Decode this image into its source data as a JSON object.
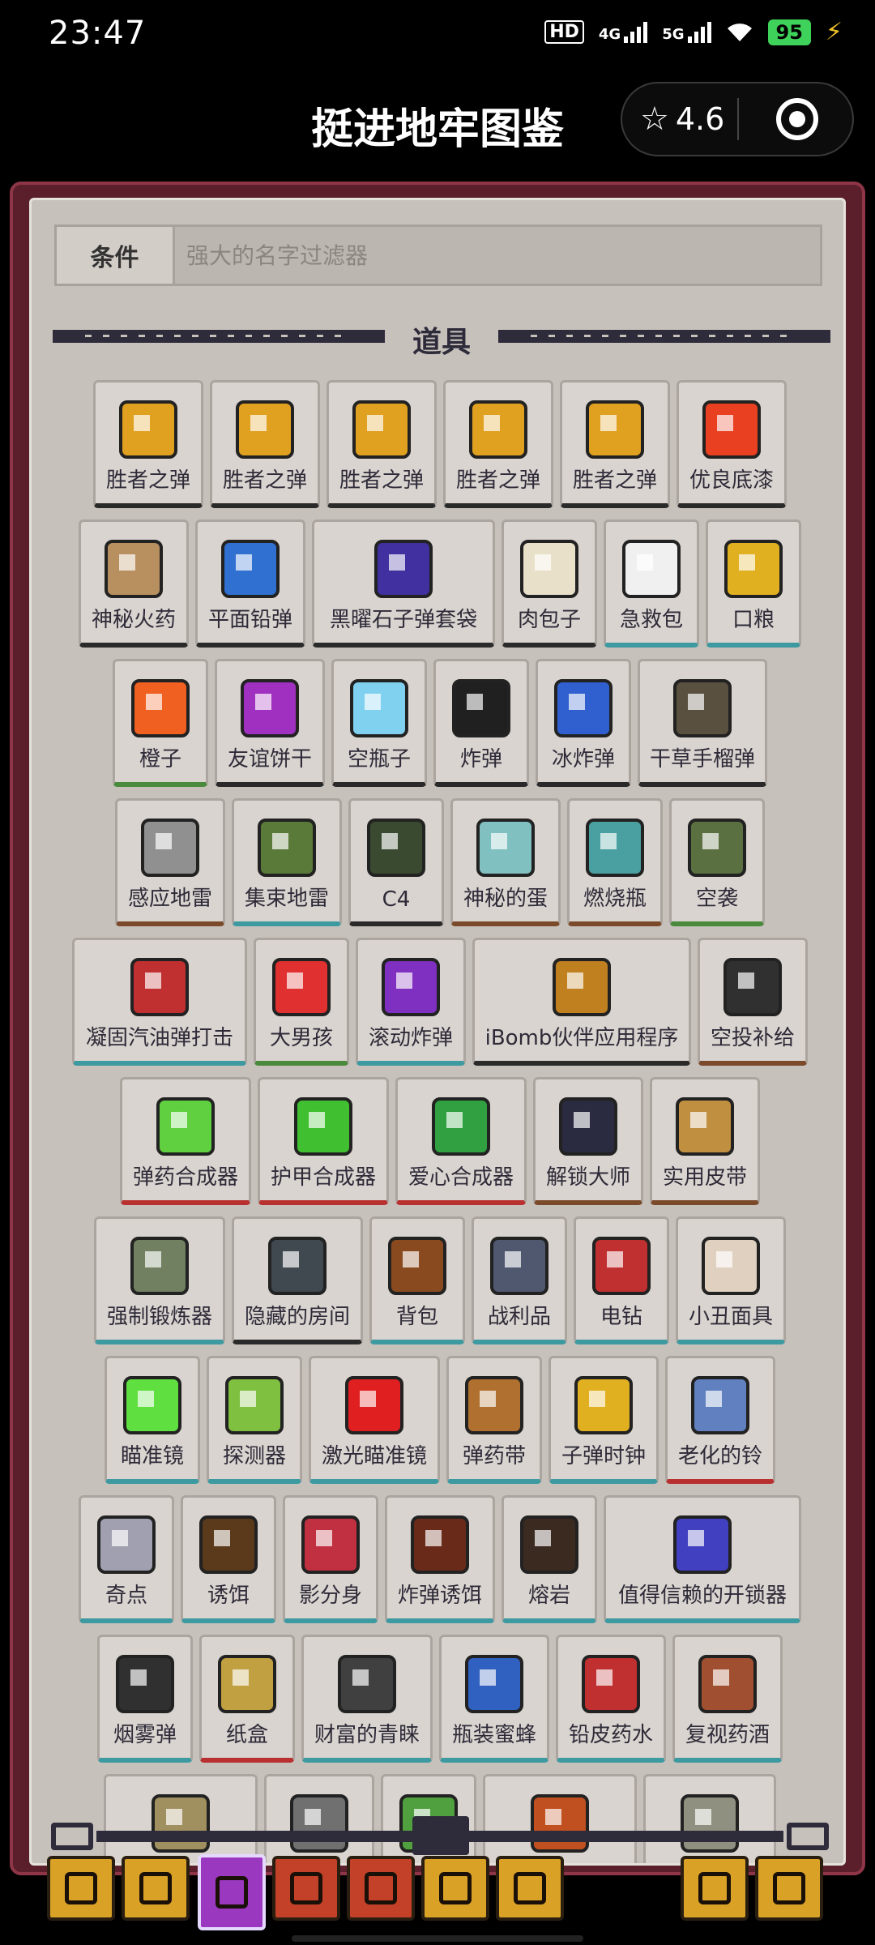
{
  "status": {
    "time": "23:47",
    "hd": "HD",
    "net1": "4G",
    "net2": "5G",
    "battery": "95"
  },
  "header": {
    "title": "挺进地牢图鉴",
    "rating": "4.6"
  },
  "search": {
    "condition_label": "条件",
    "placeholder": "强大的名字过滤器"
  },
  "section": {
    "title": "道具"
  },
  "colors": {
    "frame": "#5a1f2a",
    "panel": "#c7c1bc",
    "accent_selected_tab": "#9a38c0"
  },
  "rows": [
    [
      {
        "label": "胜者之弹",
        "icon": "bullet-i-icon",
        "color": "#e0a020",
        "edge": "b-blk"
      },
      {
        "label": "胜者之弹",
        "icon": "bullet-ii-icon",
        "color": "#e0a020",
        "edge": "b-blk"
      },
      {
        "label": "胜者之弹",
        "icon": "bullet-iii-icon",
        "color": "#e0a020",
        "edge": "b-blk"
      },
      {
        "label": "胜者之弹",
        "icon": "bullet-iv-icon",
        "color": "#e0a020",
        "edge": "b-blk"
      },
      {
        "label": "胜者之弹",
        "icon": "bullet-v-icon",
        "color": "#e0a020",
        "edge": "b-blk"
      },
      {
        "label": "优良底漆",
        "icon": "primer-icon",
        "color": "#e84020",
        "edge": "b-blk"
      }
    ],
    [
      {
        "label": "神秘火药",
        "icon": "powder-bag-icon",
        "color": "#b89060",
        "edge": "b-blk"
      },
      {
        "label": "平面铅弹",
        "icon": "blue-helmet-icon",
        "color": "#3070d0",
        "edge": "b-blk"
      },
      {
        "label": "黑曜石子弹套袋",
        "icon": "obsidian-pouch-icon",
        "color": "#4030a0",
        "edge": "b-blk"
      },
      {
        "label": "肉包子",
        "icon": "bun-icon",
        "color": "#e8e0c8",
        "edge": "b-blk"
      },
      {
        "label": "急救包",
        "icon": "medkit-icon",
        "color": "#f0f0f0",
        "edge": "b-teal"
      },
      {
        "label": "口粮",
        "icon": "ration-icon",
        "color": "#e0b020",
        "edge": "b-teal"
      }
    ],
    [
      {
        "label": "橙子",
        "icon": "orange-icon",
        "color": "#f06020",
        "edge": "b-grn"
      },
      {
        "label": "友谊饼干",
        "icon": "heart-cookie-icon",
        "color": "#a030c0",
        "edge": "b-blk"
      },
      {
        "label": "空瓶子",
        "icon": "bottle-icon",
        "color": "#80d0f0",
        "edge": "b-blk"
      },
      {
        "label": "炸弹",
        "icon": "bomb-icon",
        "color": "#202020",
        "edge": "b-blk"
      },
      {
        "label": "冰炸弹",
        "icon": "ice-bomb-icon",
        "color": "#3060d0",
        "edge": "b-blk"
      },
      {
        "label": "干草手榴弹",
        "icon": "grenade-icon",
        "color": "#5a5040",
        "edge": "b-blk"
      }
    ],
    [
      {
        "label": "感应地雷",
        "icon": "proximity-mine-icon",
        "color": "#909090",
        "edge": "b-brn"
      },
      {
        "label": "集束地雷",
        "icon": "cluster-mine-icon",
        "color": "#5a7a3a",
        "edge": "b-teal"
      },
      {
        "label": "C4",
        "icon": "c4-icon",
        "color": "#3a4a30",
        "edge": "b-blk"
      },
      {
        "label": "神秘的蛋",
        "icon": "egg-icon",
        "color": "#80c0c0",
        "edge": "b-brn"
      },
      {
        "label": "燃烧瓶",
        "icon": "molotov-icon",
        "color": "#4aa0a0",
        "edge": "b-brn"
      },
      {
        "label": "空袭",
        "icon": "airstrike-icon",
        "color": "#5a7040",
        "edge": "b-grn"
      }
    ],
    [
      {
        "label": "凝固汽油弹打击",
        "icon": "napalm-icon",
        "color": "#c03030",
        "edge": "b-teal"
      },
      {
        "label": "大男孩",
        "icon": "big-boy-icon",
        "color": "#e03030",
        "edge": "b-grn"
      },
      {
        "label": "滚动炸弹",
        "icon": "roll-bomb-icon",
        "color": "#8030c0",
        "edge": "b-teal"
      },
      {
        "label": "iBomb伙伴应用程序",
        "icon": "ibomb-icon",
        "color": "#c08020",
        "edge": "b-blk"
      },
      {
        "label": "空投补给",
        "icon": "radio-icon",
        "color": "#303030",
        "edge": "b-brn"
      }
    ],
    [
      {
        "label": "弹药合成器",
        "icon": "ammo-synth-icon",
        "color": "#60d040",
        "edge": "b-red"
      },
      {
        "label": "护甲合成器",
        "icon": "armor-synth-icon",
        "color": "#40c030",
        "edge": "b-red"
      },
      {
        "label": "爱心合成器",
        "icon": "heart-synth-icon",
        "color": "#30a040",
        "edge": "b-red"
      },
      {
        "label": "解锁大师",
        "icon": "unlock-master-icon",
        "color": "#2a2a40",
        "edge": "b-brn"
      },
      {
        "label": "实用皮带",
        "icon": "utility-belt-icon",
        "color": "#c09040",
        "edge": "b-brn"
      }
    ],
    [
      {
        "label": "强制锻炼器",
        "icon": "grip-master-icon",
        "color": "#708060",
        "edge": "b-teal"
      },
      {
        "label": "隐藏的房间",
        "icon": "hidden-room-icon",
        "color": "#404850",
        "edge": "b-blk"
      },
      {
        "label": "背包",
        "icon": "backpack-icon",
        "color": "#8a4a20",
        "edge": "b-teal"
      },
      {
        "label": "战利品",
        "icon": "loot-bag-icon",
        "color": "#505870",
        "edge": "b-teal"
      },
      {
        "label": "电钻",
        "icon": "drill-icon",
        "color": "#c03030",
        "edge": "b-teal"
      },
      {
        "label": "小丑面具",
        "icon": "clown-mask-icon",
        "color": "#e0d0c0",
        "edge": "b-teal"
      }
    ],
    [
      {
        "label": "瞄准镜",
        "icon": "scope-icon",
        "color": "#60e040",
        "edge": "b-teal"
      },
      {
        "label": "探测器",
        "icon": "detector-icon",
        "color": "#80c040",
        "edge": "b-teal"
      },
      {
        "label": "激光瞄准镜",
        "icon": "laser-sight-icon",
        "color": "#e02020",
        "edge": "b-teal"
      },
      {
        "label": "弹药带",
        "icon": "ammo-belt-icon",
        "color": "#b07030",
        "edge": "b-teal"
      },
      {
        "label": "子弹时钟",
        "icon": "bullet-clock-icon",
        "color": "#e0b020",
        "edge": "b-teal"
      },
      {
        "label": "老化的铃",
        "icon": "bell-icon",
        "color": "#6080c0",
        "edge": "b-red"
      }
    ],
    [
      {
        "label": "奇点",
        "icon": "singularity-icon",
        "color": "#a0a0b0",
        "edge": "b-teal"
      },
      {
        "label": "诱饵",
        "icon": "decoy-icon",
        "color": "#5a3a1a",
        "edge": "b-teal"
      },
      {
        "label": "影分身",
        "icon": "shadow-clone-icon",
        "color": "#c03040",
        "edge": "b-teal"
      },
      {
        "label": "炸弹诱饵",
        "icon": "bomb-decoy-icon",
        "color": "#6a2a1a",
        "edge": "b-teal"
      },
      {
        "label": "熔岩",
        "icon": "magma-icon",
        "color": "#3a2a20",
        "edge": "b-teal"
      },
      {
        "label": "值得信赖的开锁器",
        "icon": "lockpick-icon",
        "color": "#4040c0",
        "edge": "b-teal"
      }
    ],
    [
      {
        "label": "烟雾弹",
        "icon": "smoke-bomb-icon",
        "color": "#303030",
        "edge": "b-teal"
      },
      {
        "label": "纸盒",
        "icon": "cardboard-box-icon",
        "color": "#c0a040",
        "edge": "b-red"
      },
      {
        "label": "财富的青睐",
        "icon": "fortune-icon",
        "color": "#404040",
        "edge": "b-teal"
      },
      {
        "label": "瓶装蜜蜂",
        "icon": "bottled-bee-icon",
        "color": "#3060c0",
        "edge": "b-teal"
      },
      {
        "label": "铅皮药水",
        "icon": "lead-potion-icon",
        "color": "#c03030",
        "edge": "b-teal"
      },
      {
        "label": "复视药酒",
        "icon": "double-vision-icon",
        "color": "#a05030",
        "edge": "b-teal"
      }
    ],
    [
      {
        "label": "",
        "icon": "coil-icon",
        "color": "#a09060",
        "edge": "b-teal"
      },
      {
        "label": "",
        "icon": "rock-icon",
        "color": "#707070",
        "edge": "b-teal"
      },
      {
        "label": "",
        "icon": "plant-icon",
        "color": "#50a040",
        "edge": "b-teal"
      },
      {
        "label": "",
        "icon": "jar-icon",
        "color": "#c05020",
        "edge": "b-teal"
      },
      {
        "label": "",
        "icon": "stone-icon",
        "color": "#909080",
        "edge": "b-teal"
      }
    ]
  ],
  "tabs": [
    {
      "name": "tab-characters",
      "icon": "helmet-icon",
      "style": "y"
    },
    {
      "name": "tab-guns",
      "icon": "gun-icon",
      "style": "y"
    },
    {
      "name": "tab-items",
      "icon": "chest-icon",
      "style": "sel"
    },
    {
      "name": "tab-npcs",
      "icon": "npc-icon",
      "style": "r"
    },
    {
      "name": "tab-enemies",
      "icon": "skull-icon",
      "style": "r"
    },
    {
      "name": "tab-shrines",
      "icon": "shrine-icon",
      "style": "y"
    },
    {
      "name": "tab-bosses",
      "icon": "boss-icon",
      "style": "y"
    },
    {
      "name": "tab-help",
      "icon": "question-icon",
      "style": "y"
    },
    {
      "name": "tab-settings",
      "icon": "gear-icon",
      "style": "y"
    }
  ]
}
